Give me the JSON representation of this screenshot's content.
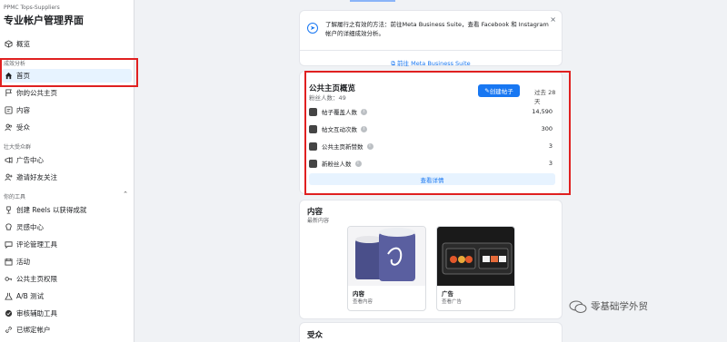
{
  "sidebar": {
    "org": "PPMC Tops-Suppliers",
    "title": "专业帐户管理界面",
    "overview": "概览",
    "section_insights": "成效分析",
    "home": "首页",
    "public_page": "你的公共主页",
    "content": "内容",
    "audience": "受众",
    "section_growth": "壮大受众群",
    "ad_center": "广告中心",
    "invite": "邀请好友关注",
    "section_tools": "你的工具",
    "reels": "创建 Reels 以获得成就",
    "inspiration": "灵感中心",
    "comments": "评论管理工具",
    "events": "活动",
    "page_access": "公共主页权限",
    "ab_test": "A/B 测试",
    "review": "审核辅助工具",
    "linked": "已绑定帐户"
  },
  "banner": {
    "text": "了解履行之有效的方法：前往Meta Business Suite，查看 Facebook 和 Instagram 帐户的详细成效分析。",
    "link": "前往 Meta Business Suite",
    "close": "×"
  },
  "overview": {
    "title": "公共主页概览",
    "fans": "粉丝人数：49",
    "create_button": "创建帖子",
    "range": "过去 28 天",
    "metrics": [
      {
        "label": "帖子覆盖人数",
        "value": "14,590"
      },
      {
        "label": "帖文互动次数",
        "value": "300"
      },
      {
        "label": "公共主页新赞数",
        "value": "3"
      },
      {
        "label": "新粉丝人数",
        "value": "3"
      }
    ],
    "view_details": "查看详情"
  },
  "content_card": {
    "title": "内容",
    "subtitle": "最新内容",
    "tiles": [
      {
        "title": "内容",
        "sub": "查看内容"
      },
      {
        "title": "广告",
        "sub": "查看广告"
      }
    ]
  },
  "audience_card": {
    "title": "受众"
  },
  "watermark": {
    "text": "零基础学外贸"
  },
  "colors": {
    "accent": "#1877f2",
    "highlight": "#e02020"
  }
}
